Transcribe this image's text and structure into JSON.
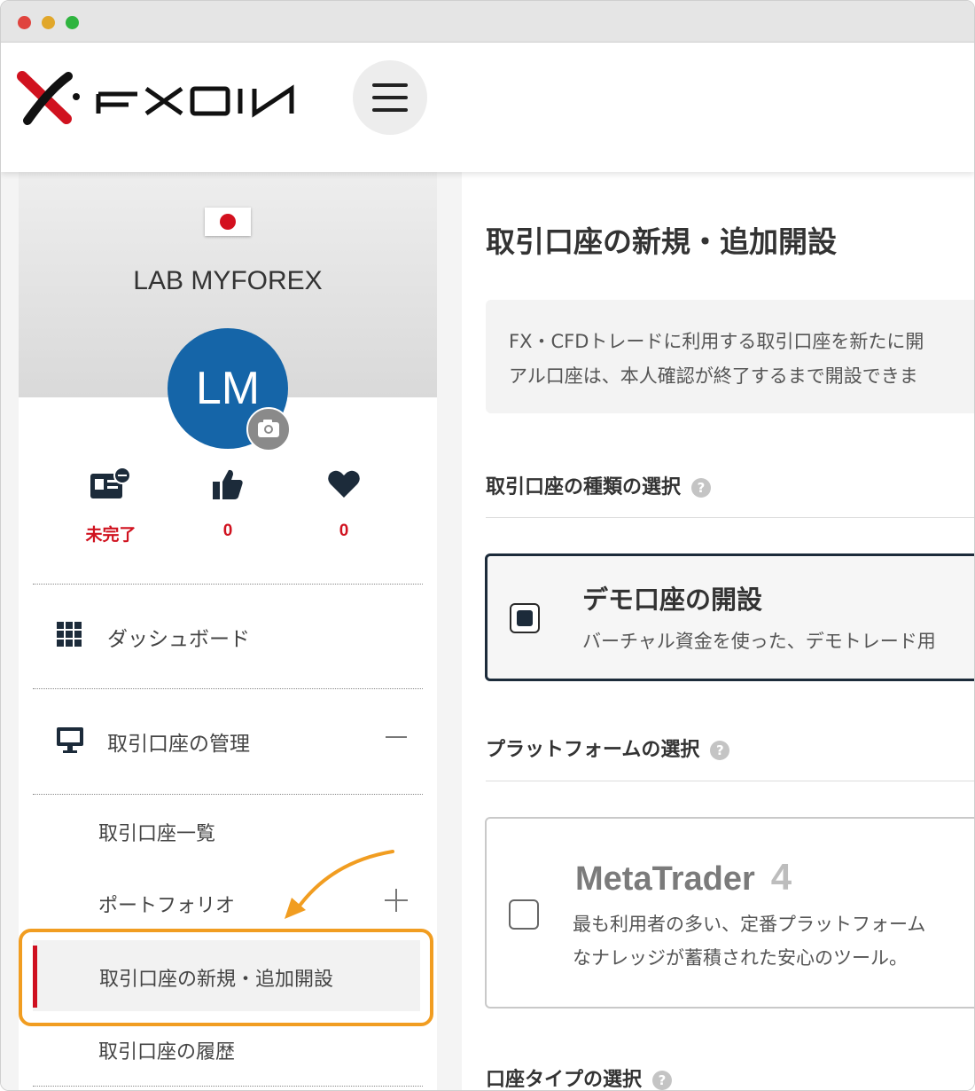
{
  "brand": {
    "logo_text": "FXON"
  },
  "sidebar": {
    "username": "LAB MYFOREX",
    "avatar_initials": "LM",
    "stats": [
      {
        "icon": "id-card-icon",
        "value": "未完了"
      },
      {
        "icon": "thumbs-up-icon",
        "value": "0"
      },
      {
        "icon": "heart-icon",
        "value": "0"
      }
    ],
    "nav": {
      "dashboard": "ダッシュボード",
      "account_management": "取引口座の管理"
    },
    "sub_items": {
      "account_list": "取引口座一覧",
      "portfolio": "ポートフォリオ",
      "new_account": "取引口座の新規・追加開設",
      "history": "取引口座の履歴"
    }
  },
  "main": {
    "title": "取引口座の新規・追加開設",
    "info_lines": [
      "FX・CFDトレードに利用する取引口座を新たに開",
      "アル口座は、本人確認が終了するまで開設できま"
    ],
    "sections": {
      "account_type": "取引口座の種類の選択",
      "platform": "プラットフォームの選択",
      "account_kind": "口座タイプの選択"
    },
    "demo_card": {
      "title": "デモ口座の開設",
      "desc": "バーチャル資金を使った、デモトレード用"
    },
    "mt4_card": {
      "brand": "MetaTrader",
      "version": "4",
      "desc1": "最も利用者の多い、定番プラットフォーム",
      "desc2": "なナレッジが蓄積された安心のツール。"
    },
    "help_glyph": "?"
  },
  "colors": {
    "accent_red": "#d0121f",
    "avatar_blue": "#1565a8",
    "highlight_orange": "#f19d21",
    "selected_border": "#1c2b3a"
  }
}
